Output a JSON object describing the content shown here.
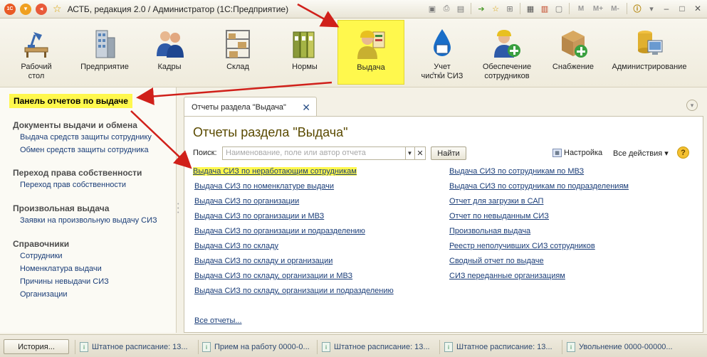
{
  "window": {
    "title": "АСТБ, редакция 2.0 / Администратор  (1С:Предприятие)",
    "logo_text": "1C",
    "tools": [
      "M",
      "M+",
      "M-"
    ]
  },
  "sections": [
    {
      "label": "Рабочий\nстол",
      "icon": "desk-lamp-icon"
    },
    {
      "label": "Предприятие",
      "icon": "building-icon"
    },
    {
      "label": "Кадры",
      "icon": "people-icon"
    },
    {
      "label": "Склад",
      "icon": "warehouse-shelves-icon"
    },
    {
      "label": "Нормы",
      "icon": "folders-icon"
    },
    {
      "label": "Выдача",
      "icon": "worker-card-icon"
    },
    {
      "label": "Учет\nчистки СИЗ",
      "icon": "water-drop-icon"
    },
    {
      "label": "Обеспечение\nсотрудников",
      "icon": "worker-plus-icon"
    },
    {
      "label": "Снабжение",
      "icon": "box-plus-icon"
    },
    {
      "label": "Администрирование",
      "icon": "database-computer-icon"
    }
  ],
  "sidebar": {
    "title": "Панель отчетов по выдаче",
    "groups": [
      {
        "title": "Документы выдачи и обмена",
        "items": [
          "Выдача средств защиты сотруднику",
          "Обмен средств защиты сотрудника"
        ]
      },
      {
        "title": "Переход права собственности",
        "items": [
          "Переход прав собственности"
        ]
      },
      {
        "title": "Произвольная выдача",
        "items": [
          "Заявки на произвольную выдачу СИЗ"
        ]
      },
      {
        "title": "Справочники",
        "items": [
          "Сотрудники",
          "Номенклатура выдачи",
          "Причины невыдачи СИЗ",
          "Организации"
        ]
      }
    ]
  },
  "tab": {
    "label": "Отчеты раздела \"Выдача\"",
    "close": "✕"
  },
  "form": {
    "title": "Отчеты раздела \"Выдача\"",
    "search_label": "Поиск:",
    "search_placeholder": "Наименование, поле или автор отчета",
    "find_button": "Найти",
    "settings_label": "Настройка",
    "all_actions_label": "Все действия ▾",
    "help": "?",
    "reports_left": [
      "Выдача СИЗ по неработающим сотрудникам",
      "Выдача СИЗ по номенклатуре выдачи",
      "Выдача СИЗ по организации",
      "Выдача СИЗ по организации и МВЗ",
      "Выдача СИЗ по организации и подразделению",
      "Выдача СИЗ по складу",
      "Выдача СИЗ по складу и организации",
      "Выдача СИЗ по складу, организации и МВЗ",
      "Выдача СИЗ по складу, организации и подразделению"
    ],
    "reports_right": [
      "Выдача СИЗ по сотрудникам по МВЗ",
      "Выдача СИЗ по сотрудникам по подразделениям",
      "Отчет для загрузки в САП",
      "Отчет по невыданным СИЗ",
      "Произвольная выдача",
      "Реестр неполучивших СИЗ сотрудников",
      "Сводный отчет по выдаче",
      "СИЗ переданные организациям"
    ],
    "all_reports": "Все отчеты..."
  },
  "taskbar": {
    "history_button": "История...",
    "tasks": [
      "Штатное расписание: 13...",
      "Прием на работу 0000-0...",
      "Штатное расписание: 13...",
      "Штатное расписание: 13...",
      "Увольнение 0000-00000..."
    ]
  },
  "colors": {
    "highlight": "#fff84d",
    "link": "#1a3d78",
    "title": "#5a4a00",
    "arrow": "#d0201a"
  }
}
